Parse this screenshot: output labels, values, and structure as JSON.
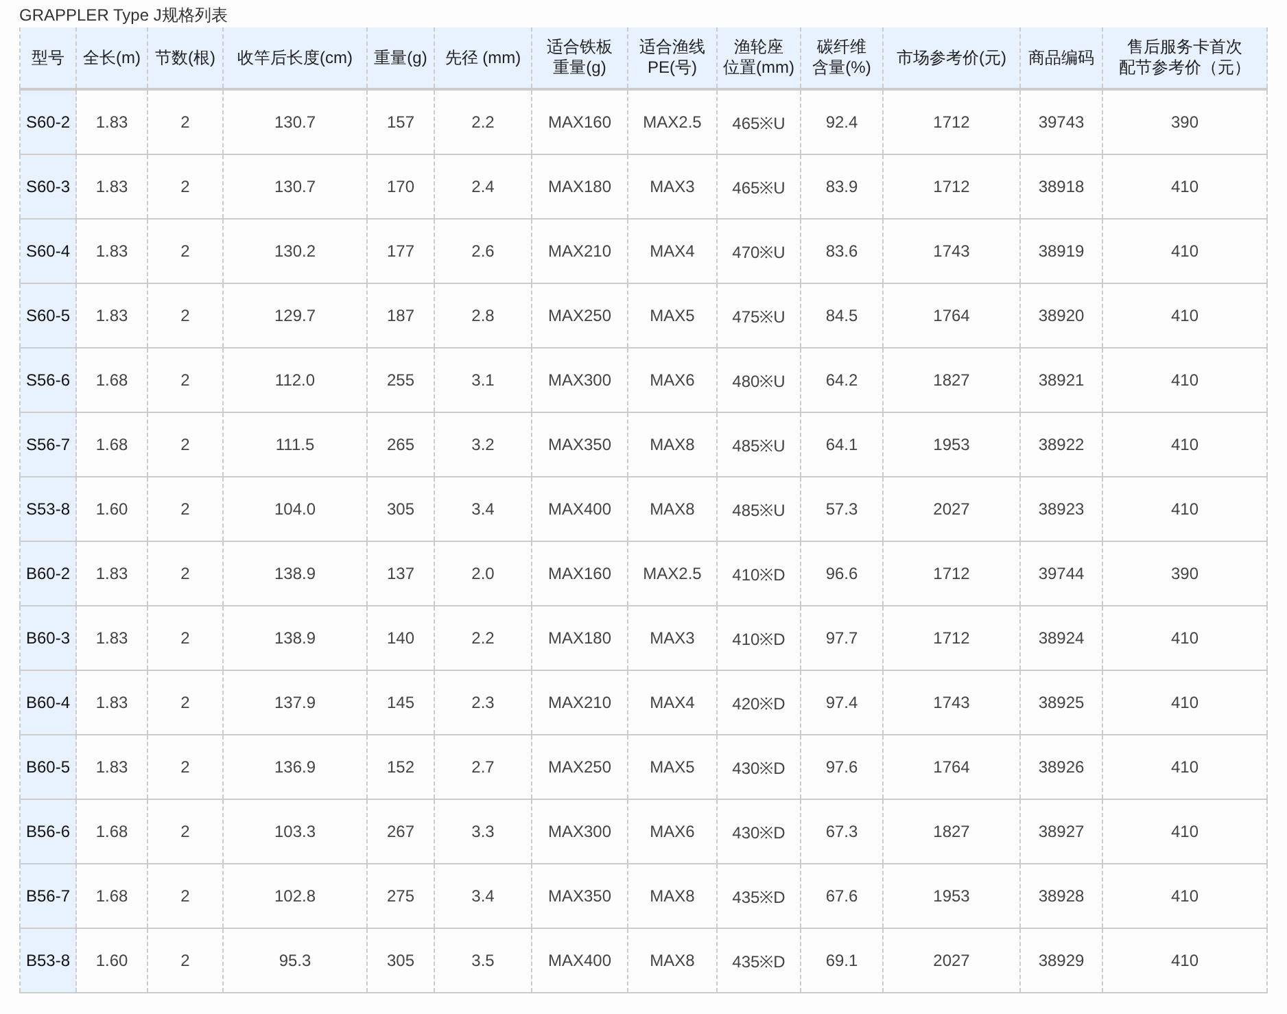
{
  "title": "GRAPPLER Type J规格列表",
  "table": {
    "columns": [
      {
        "lines": [
          "型号"
        ]
      },
      {
        "lines": [
          "全长(m)"
        ]
      },
      {
        "lines": [
          "节数(根)"
        ]
      },
      {
        "lines": [
          "收竿后长度(cm)"
        ]
      },
      {
        "lines": [
          "重量(g)"
        ]
      },
      {
        "lines": [
          "先径 (mm)"
        ]
      },
      {
        "lines": [
          "适合铁板",
          "重量(g)"
        ]
      },
      {
        "lines": [
          "适合渔线",
          "PE(号)"
        ]
      },
      {
        "lines": [
          "渔轮座",
          "位置(mm)"
        ]
      },
      {
        "lines": [
          "碳纤维",
          "含量(%)"
        ]
      },
      {
        "lines": [
          "市场参考价(元)"
        ]
      },
      {
        "lines": [
          "商品编码"
        ]
      },
      {
        "lines": [
          "售后服务卡首次",
          "配节参考价（元）"
        ]
      }
    ],
    "rows": [
      [
        "S60-2",
        "1.83",
        "2",
        "130.7",
        "157",
        "2.2",
        "MAX160",
        "MAX2.5",
        "465※U",
        "92.4",
        "1712",
        "39743",
        "390"
      ],
      [
        "S60-3",
        "1.83",
        "2",
        "130.7",
        "170",
        "2.4",
        "MAX180",
        "MAX3",
        "465※U",
        "83.9",
        "1712",
        "38918",
        "410"
      ],
      [
        "S60-4",
        "1.83",
        "2",
        "130.2",
        "177",
        "2.6",
        "MAX210",
        "MAX4",
        "470※U",
        "83.6",
        "1743",
        "38919",
        "410"
      ],
      [
        "S60-5",
        "1.83",
        "2",
        "129.7",
        "187",
        "2.8",
        "MAX250",
        "MAX5",
        "475※U",
        "84.5",
        "1764",
        "38920",
        "410"
      ],
      [
        "S56-6",
        "1.68",
        "2",
        "112.0",
        "255",
        "3.1",
        "MAX300",
        "MAX6",
        "480※U",
        "64.2",
        "1827",
        "38921",
        "410"
      ],
      [
        "S56-7",
        "1.68",
        "2",
        "111.5",
        "265",
        "3.2",
        "MAX350",
        "MAX8",
        "485※U",
        "64.1",
        "1953",
        "38922",
        "410"
      ],
      [
        "S53-8",
        "1.60",
        "2",
        "104.0",
        "305",
        "3.4",
        "MAX400",
        "MAX8",
        "485※U",
        "57.3",
        "2027",
        "38923",
        "410"
      ],
      [
        "B60-2",
        "1.83",
        "2",
        "138.9",
        "137",
        "2.0",
        "MAX160",
        "MAX2.5",
        "410※D",
        "96.6",
        "1712",
        "39744",
        "390"
      ],
      [
        "B60-3",
        "1.83",
        "2",
        "138.9",
        "140",
        "2.2",
        "MAX180",
        "MAX3",
        "410※D",
        "97.7",
        "1712",
        "38924",
        "410"
      ],
      [
        "B60-4",
        "1.83",
        "2",
        "137.9",
        "145",
        "2.3",
        "MAX210",
        "MAX4",
        "420※D",
        "97.4",
        "1743",
        "38925",
        "410"
      ],
      [
        "B60-5",
        "1.83",
        "2",
        "136.9",
        "152",
        "2.7",
        "MAX250",
        "MAX5",
        "430※D",
        "97.6",
        "1764",
        "38926",
        "410"
      ],
      [
        "B56-6",
        "1.68",
        "2",
        "103.3",
        "267",
        "3.3",
        "MAX300",
        "MAX6",
        "430※D",
        "67.3",
        "1827",
        "38927",
        "410"
      ],
      [
        "B56-7",
        "1.68",
        "2",
        "102.8",
        "275",
        "3.4",
        "MAX350",
        "MAX8",
        "435※D",
        "67.6",
        "1953",
        "38928",
        "410"
      ],
      [
        "B53-8",
        "1.60",
        "2",
        "95.3",
        "305",
        "3.5",
        "MAX400",
        "MAX8",
        "435※D",
        "69.1",
        "2027",
        "38929",
        "410"
      ]
    ]
  }
}
